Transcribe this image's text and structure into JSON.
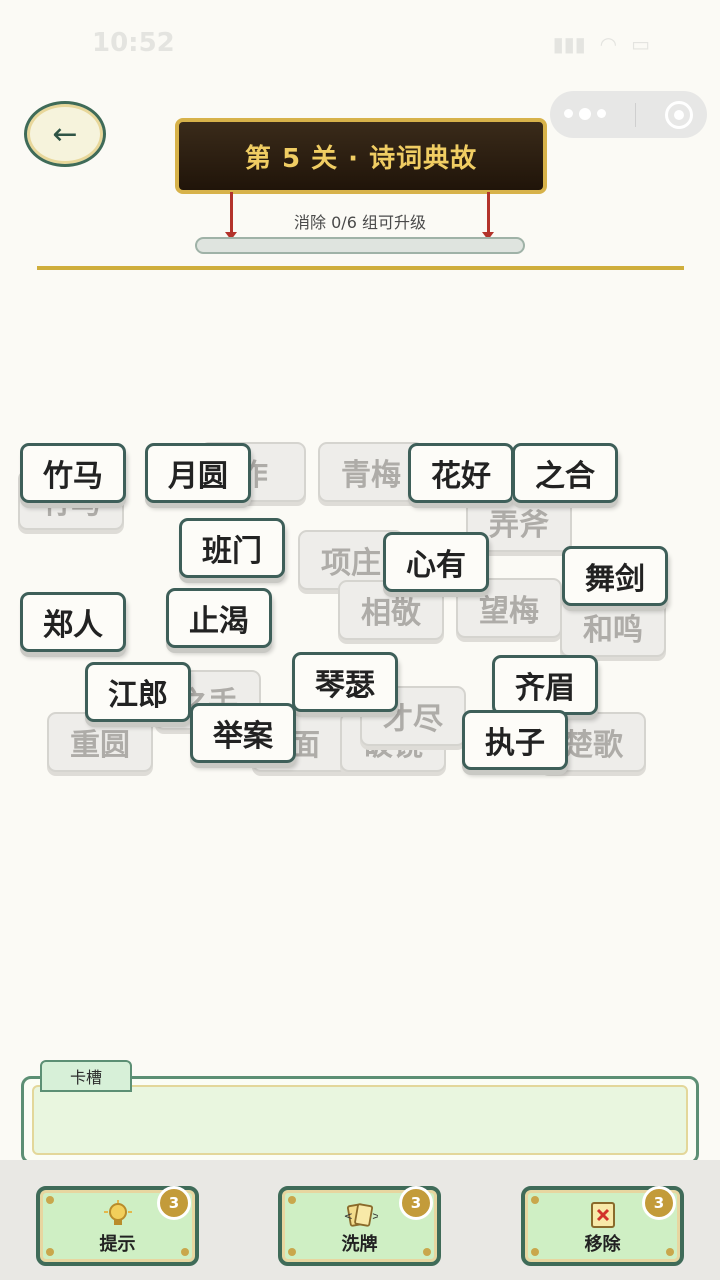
{
  "status_bar": {
    "time": "10:52"
  },
  "header": {
    "back_icon": "arrow-left-icon",
    "back_glyph": "←",
    "level_title": "第 5 关 · 诗词典故",
    "progress_text": "消除 0/6 组可升级",
    "progress_value": 0,
    "progress_total": 6
  },
  "tiles_dim": [
    "竹马",
    "青梅",
    "作",
    "弄斧",
    "项庄",
    "相敬",
    "望梅",
    "和鸣",
    "之手",
    "重圆",
    "面",
    "破镜",
    "才尽",
    "楚歌"
  ],
  "tiles": [
    "竹马",
    "月圆",
    "花好",
    "之合",
    "班门",
    "心有",
    "舞剑",
    "郑人",
    "止渴",
    "琴瑟",
    "江郎",
    "齐眉",
    "举案",
    "执子"
  ],
  "card_slot": {
    "label": "卡槽"
  },
  "tools": {
    "hint": {
      "label": "提示",
      "count": "3",
      "icon": "lightbulb-icon"
    },
    "shuffle": {
      "label": "洗牌",
      "count": "3",
      "icon": "cards-icon"
    },
    "remove": {
      "label": "移除",
      "count": "3",
      "icon": "remove-x-icon"
    }
  },
  "colors": {
    "accent_green": "#3f6b58",
    "banner_gold": "#f0cd63",
    "badge_gold": "#c39b3a",
    "rope_red": "#b3332b"
  }
}
